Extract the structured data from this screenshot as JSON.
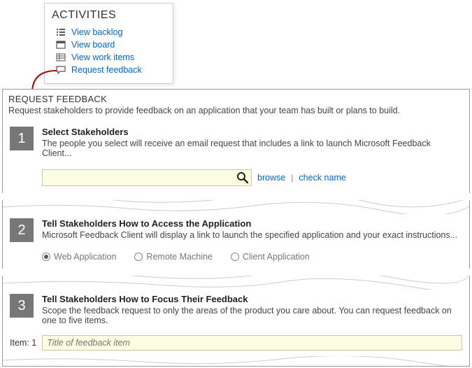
{
  "activities": {
    "title": "ACTIVITIES",
    "items": [
      {
        "label": "View backlog"
      },
      {
        "label": "View board"
      },
      {
        "label": "View work items"
      },
      {
        "label": "Request feedback"
      }
    ]
  },
  "panel": {
    "title": "REQUEST FEEDBACK",
    "description": "Request stakeholders to provide feedback on an application that your team has built or plans to build."
  },
  "steps": {
    "s1": {
      "num": "1",
      "title": "Select Stakeholders",
      "desc": "The people you select will receive an email request that includes a link to launch Microsoft Feedback Client...",
      "browse": "browse",
      "checkname": "check name"
    },
    "s2": {
      "num": "2",
      "title": "Tell Stakeholders How to Access the Application",
      "desc": "Microsoft Feedback Client will display a link to launch the specified application and your exact instructions...",
      "opt_web": "Web Application",
      "opt_remote": "Remote Machine",
      "opt_client": "Client Application"
    },
    "s3": {
      "num": "3",
      "title": "Tell Stakeholders How to Focus Their Feedback",
      "desc": "Scope the feedback request to only the areas of the product you care about. You can request feedback on one to five items.",
      "item_label": "Item: 1",
      "item_placeholder": "Title of feedback item"
    }
  }
}
